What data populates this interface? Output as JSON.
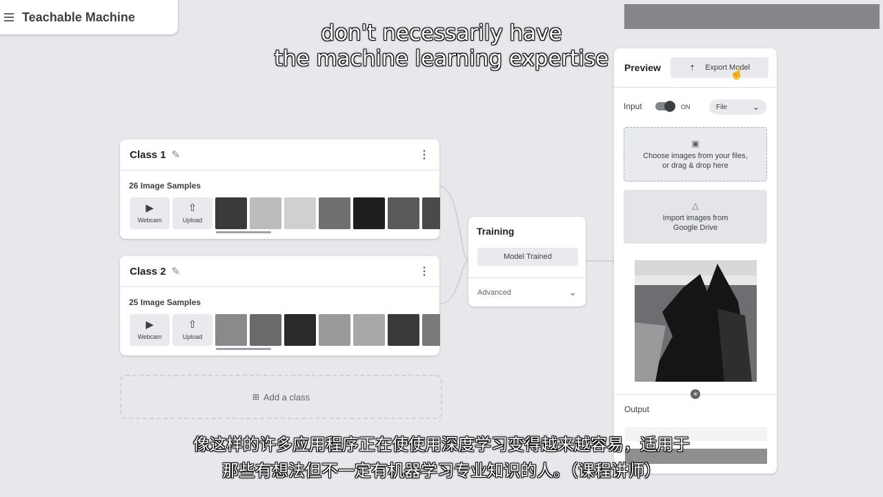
{
  "app": {
    "title": "Teachable Machine"
  },
  "classes": [
    {
      "name": "Class 1",
      "samples": "26 Image Samples",
      "webcam": "Webcam",
      "upload": "Upload",
      "thumb_colors": [
        "#3a3a3a",
        "#bcbcbc",
        "#d0d0d0",
        "#707070",
        "#1e1e1e",
        "#5a5a5a",
        "#4a4a4a"
      ]
    },
    {
      "name": "Class 2",
      "samples": "25 Image Samples",
      "webcam": "Webcam",
      "upload": "Upload",
      "thumb_colors": [
        "#8a8a8a",
        "#6a6a6a",
        "#2a2a2a",
        "#9a9a9a",
        "#a8a8a8",
        "#3a3a3a",
        "#7a7a7a"
      ]
    }
  ],
  "add_class": {
    "label": "Add a class"
  },
  "training": {
    "title": "Training",
    "button": "Model Trained",
    "advanced": "Advanced"
  },
  "preview": {
    "title": "Preview",
    "export": "Export Model",
    "input_label": "Input",
    "toggle_state": "ON",
    "source_select": "File",
    "drop_line1": "Choose images from your files,",
    "drop_line2": "or drag & drop here",
    "drive_line1": "Import images from",
    "drive_line2": "Google Drive",
    "output_label": "Output"
  },
  "captions": {
    "en_line1": "don't necessarily have",
    "en_line2": "the machine learning expertise",
    "cn_line1": "像这样的许多应用程序正在使使用深度学习变得越来越容易，适用于",
    "cn_line2": "那些有想法但不一定有机器学习专业知识的人。（课程讲师）"
  },
  "icons": {
    "menu": "menu-icon",
    "edit": "pencil-icon",
    "more": "kebab-icon",
    "webcam": "video-icon",
    "upload": "upload-icon",
    "add": "add-box-icon",
    "expand": "chevron-down-icon",
    "export": "export-icon",
    "folder": "folder-icon",
    "drive": "drive-icon"
  }
}
